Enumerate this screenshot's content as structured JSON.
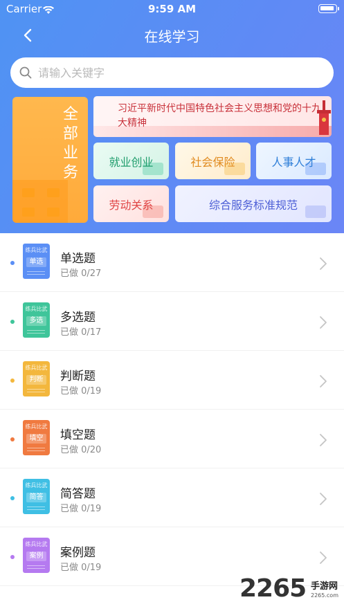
{
  "status_bar": {
    "carrier": "Carrier",
    "time": "9:59 AM"
  },
  "nav": {
    "title": "在线学习"
  },
  "search": {
    "placeholder": "请输入关键字"
  },
  "all_business": {
    "label": "全部业务"
  },
  "banner": {
    "text": "习近平新时代中国特色社会主义思想和党的十九大精神"
  },
  "categories": [
    {
      "label": "就业创业",
      "color": "#1f9d6c"
    },
    {
      "label": "社会保险",
      "color": "#e08a1e"
    },
    {
      "label": "人事人才",
      "color": "#2f7fd8"
    },
    {
      "label": "劳动关系",
      "color": "#e04545"
    },
    {
      "label": "综合服务标准规范",
      "color": "#4d5fd6"
    }
  ],
  "book_caption": "练兵比武",
  "question_types": [
    {
      "title": "单选题",
      "progress": "已做 0/27",
      "badge": "单选",
      "color": "#5b8ff5"
    },
    {
      "title": "多选题",
      "progress": "已做 0/17",
      "badge": "多选",
      "color": "#3fc59a"
    },
    {
      "title": "判断题",
      "progress": "已做 0/19",
      "badge": "判断",
      "color": "#f3b73d"
    },
    {
      "title": "填空题",
      "progress": "已做 0/20",
      "badge": "填空",
      "color": "#f07a40"
    },
    {
      "title": "简答题",
      "progress": "已做 0/19",
      "badge": "简答",
      "color": "#3fbfe4"
    },
    {
      "title": "案例题",
      "progress": "已做 0/19",
      "badge": "案例",
      "color": "#b57af0"
    }
  ],
  "watermark": {
    "number": "2265",
    "text": "手游网",
    "domain": "2265.com"
  }
}
